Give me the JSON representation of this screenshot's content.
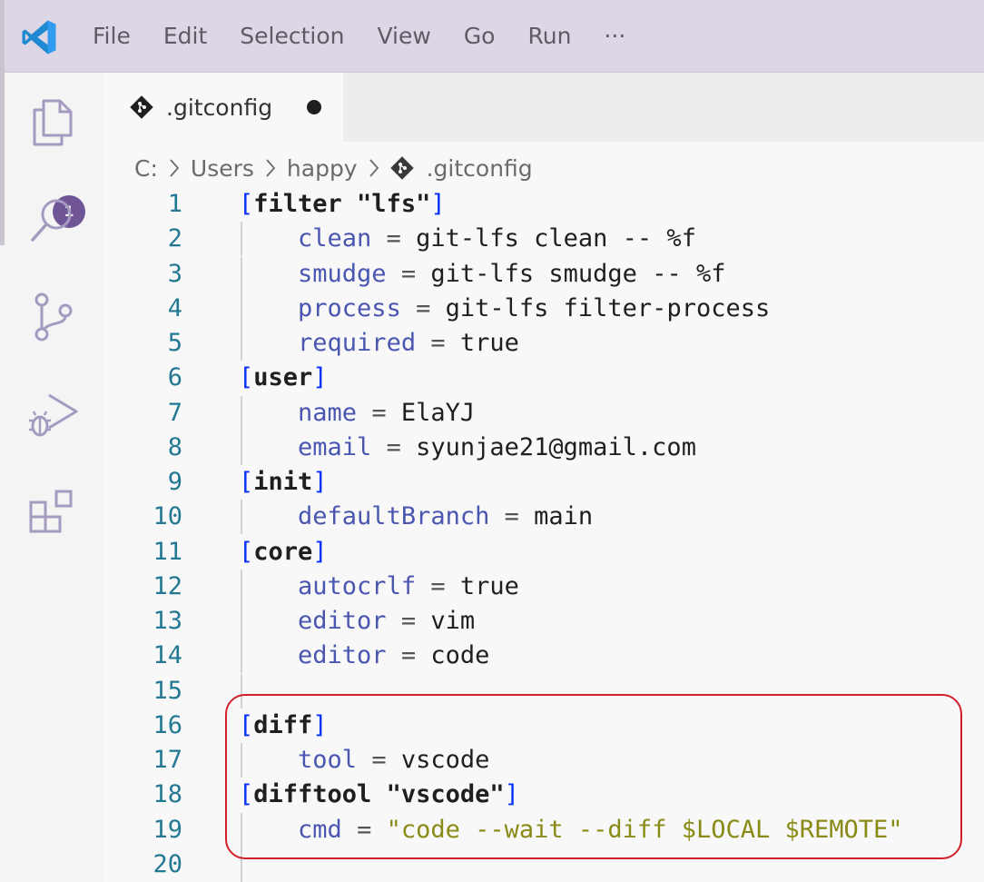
{
  "menu": [
    "File",
    "Edit",
    "Selection",
    "View",
    "Go",
    "Run",
    "···"
  ],
  "activity_bar": {
    "explorer_badge": "1",
    "icons": [
      "explorer-icon",
      "search-icon",
      "source-control-icon",
      "run-debug-icon",
      "extensions-icon"
    ]
  },
  "tab": {
    "label": ".gitconfig",
    "dirty": true
  },
  "breadcrumb": {
    "drive": "C:",
    "folder1": "Users",
    "folder2": "happy",
    "file": ".gitconfig"
  },
  "editor": {
    "language": "gitconfig",
    "lines": [
      {
        "num": "1",
        "section": "filter \"lfs\""
      },
      {
        "num": "2",
        "key": "clean",
        "value": "git-lfs clean -- %f"
      },
      {
        "num": "3",
        "key": "smudge",
        "value": "git-lfs smudge -- %f"
      },
      {
        "num": "4",
        "key": "process",
        "value": "git-lfs filter-process"
      },
      {
        "num": "5",
        "key": "required",
        "value": "true"
      },
      {
        "num": "6",
        "section": "user"
      },
      {
        "num": "7",
        "key": "name",
        "value": "ElaYJ"
      },
      {
        "num": "8",
        "key": "email",
        "value": "syunjae21@gmail.com"
      },
      {
        "num": "9",
        "section": "init"
      },
      {
        "num": "10",
        "key": "defaultBranch",
        "value": "main"
      },
      {
        "num": "11",
        "section": "core"
      },
      {
        "num": "12",
        "key": "autocrlf",
        "value": "true"
      },
      {
        "num": "13",
        "key": "editor",
        "value": "vim"
      },
      {
        "num": "14",
        "key": "editor",
        "value": "code"
      },
      {
        "num": "15",
        "blank": true
      },
      {
        "num": "16",
        "section": "diff"
      },
      {
        "num": "17",
        "key": "tool",
        "value": "vscode"
      },
      {
        "num": "18",
        "section": "difftool \"vscode\""
      },
      {
        "num": "19",
        "key": "cmd",
        "string": "\"code --wait --diff $LOCAL $REMOTE\""
      },
      {
        "num": "20",
        "blank": true
      }
    ]
  },
  "colors": {
    "highlight_border": "#d0202a",
    "bracket": "#0431fa",
    "key": "#4a56b0",
    "string": "#8a8a16",
    "line_number": "#237893",
    "badge": "#6f5596"
  }
}
